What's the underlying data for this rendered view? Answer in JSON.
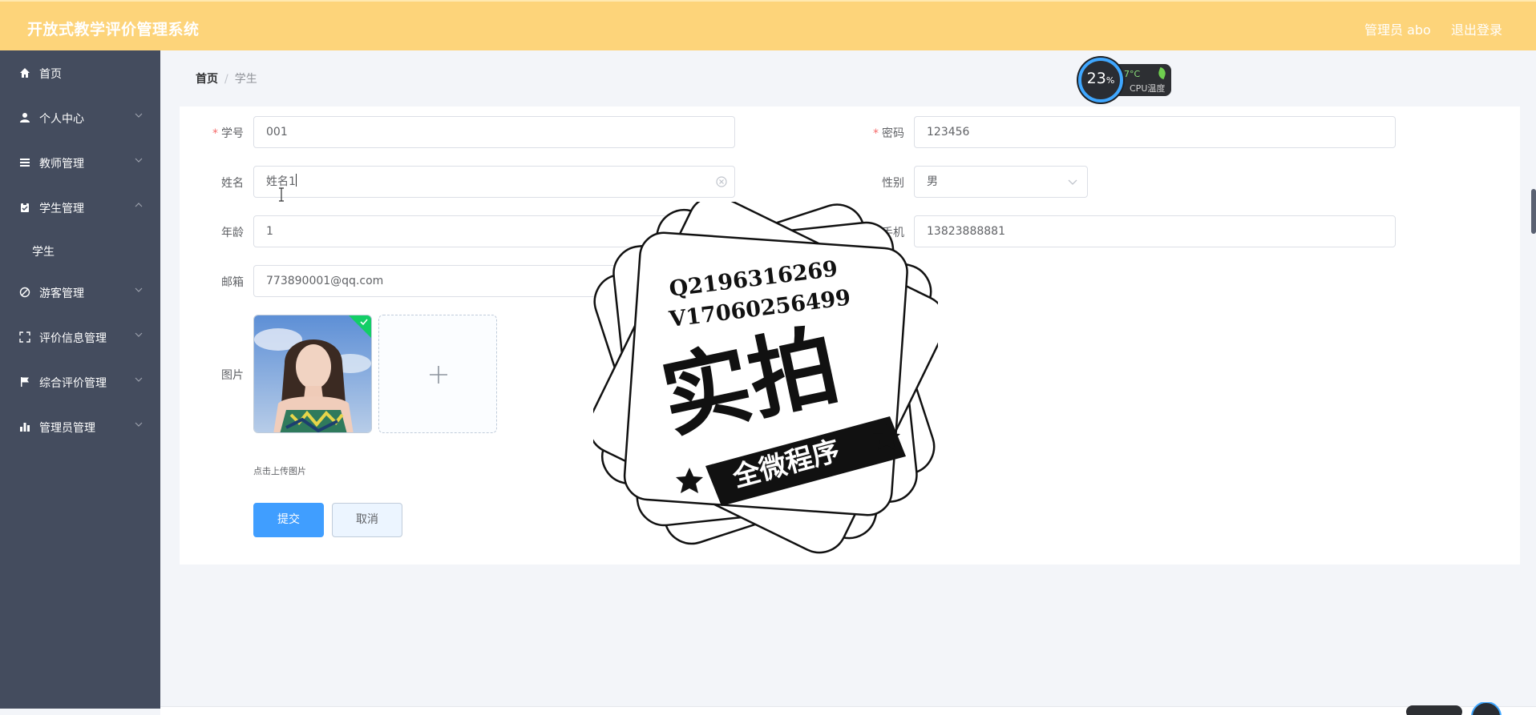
{
  "header": {
    "title": "开放式教学评价管理系统",
    "user": "管理员 abo",
    "logout": "退出登录"
  },
  "sidebar": {
    "items": [
      {
        "label": "首页",
        "icon": "home-icon"
      },
      {
        "label": "个人中心",
        "icon": "user-icon"
      },
      {
        "label": "教师管理",
        "icon": "list-icon"
      },
      {
        "label": "学生管理",
        "icon": "clipboard-icon",
        "expanded": true,
        "children": [
          {
            "label": "学生"
          }
        ]
      },
      {
        "label": "游客管理",
        "icon": "no-entry-icon"
      },
      {
        "label": "评价信息管理",
        "icon": "full-screen-icon"
      },
      {
        "label": "综合评价管理",
        "icon": "flag-icon"
      },
      {
        "label": "管理员管理",
        "icon": "bar-chart-icon"
      }
    ]
  },
  "breadcrumb": {
    "home": "首页",
    "separator": "/",
    "current": "学生"
  },
  "cpu_widget": {
    "percent": "23",
    "percent_unit": "%",
    "temp": "37°C",
    "label": "CPU温度"
  },
  "form": {
    "student_id": {
      "label": "学号",
      "value": "001",
      "required": true
    },
    "password": {
      "label": "密码",
      "value": "123456",
      "required": true
    },
    "name": {
      "label": "姓名",
      "value": "姓名1"
    },
    "gender": {
      "label": "性别",
      "value": "男"
    },
    "age": {
      "label": "年龄",
      "value": "1"
    },
    "phone": {
      "label": "手机",
      "value": "13823888881"
    },
    "email": {
      "label": "邮箱",
      "value": "773890001@qq.com"
    },
    "image": {
      "label": "图片",
      "tip": "点击上传图片"
    },
    "submit": "提交",
    "cancel": "取消"
  },
  "stamp": {
    "line1": "Q2196316269",
    "line2": "V17060256499",
    "big": "实拍",
    "ribbon": "全微程序"
  },
  "colors": {
    "header": "#fdd47a",
    "sidebar": "#444c5e",
    "primary": "#409eff",
    "required": "#f56c6c"
  }
}
